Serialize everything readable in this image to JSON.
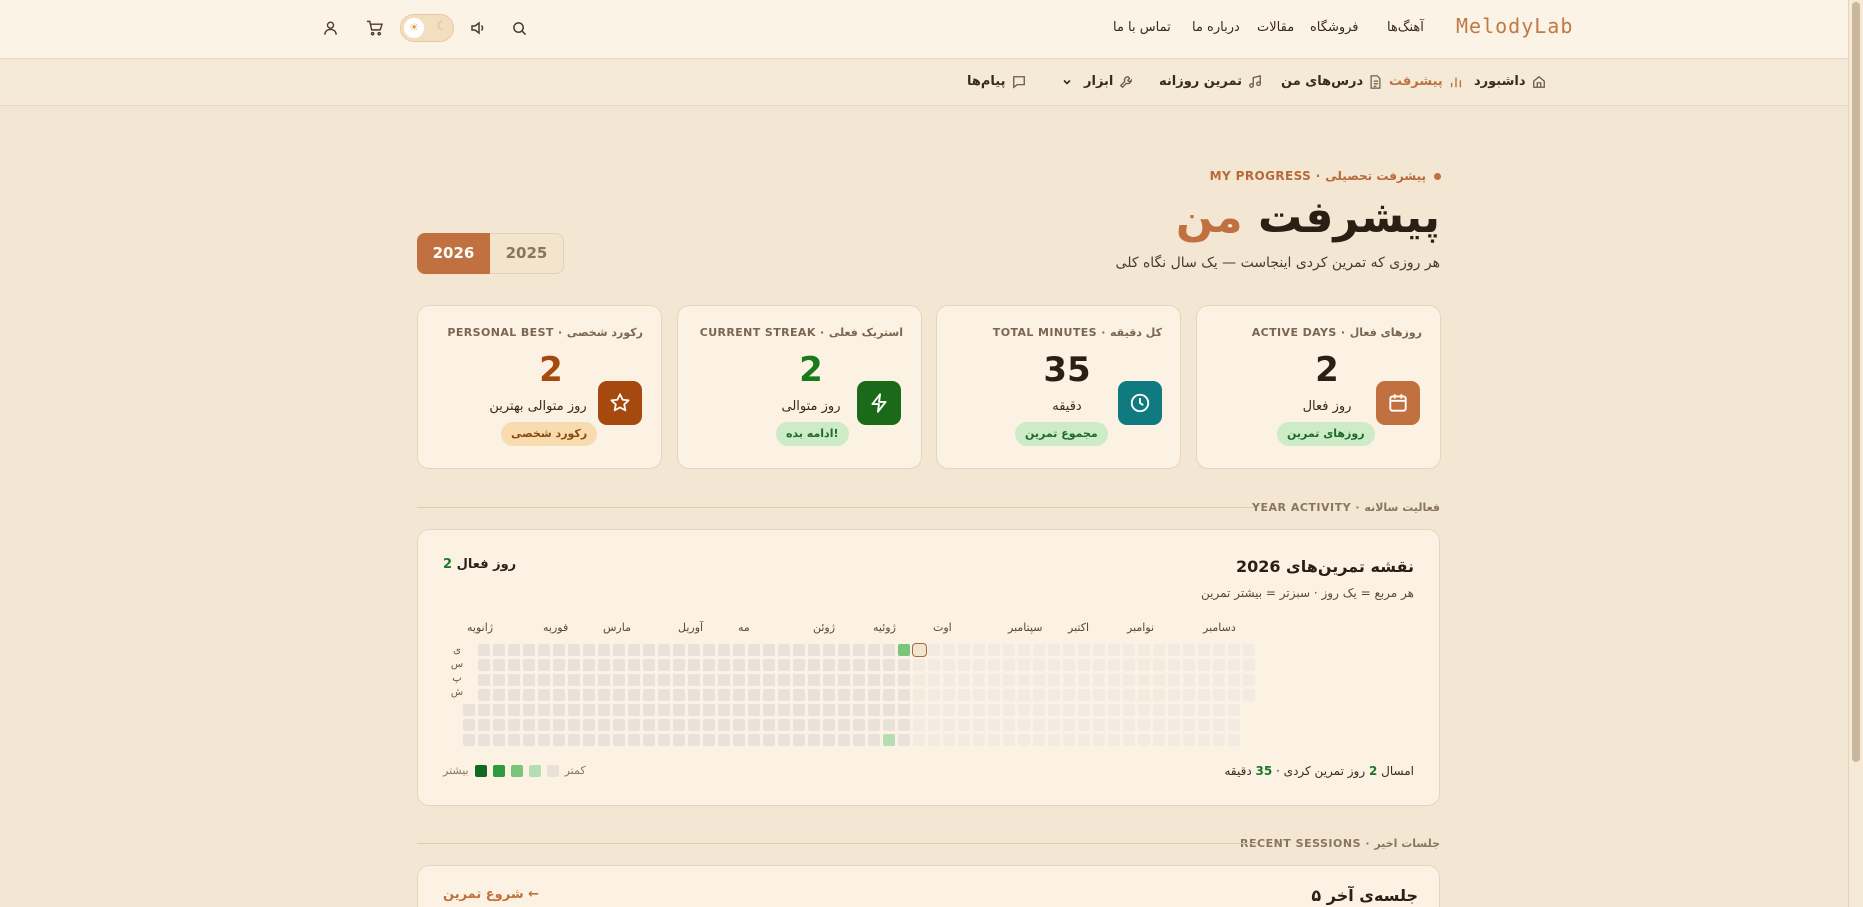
{
  "brand": {
    "logo": "MelodyLab"
  },
  "top_nav": [
    "آهنگ‌ها",
    "فروشگاه",
    "مقالات",
    "درباره ما",
    "تماس با ما"
  ],
  "sub_nav": [
    {
      "label": "داشبورد",
      "icon": "home-icon"
    },
    {
      "label": "پیشرفت",
      "icon": "chart-bars-icon",
      "active": true
    },
    {
      "label": "درس‌های من",
      "icon": "document-icon"
    },
    {
      "label": "تمرین روزانه",
      "icon": "music-note-icon"
    },
    {
      "label": "ابزار",
      "icon": "wrench-icon"
    },
    {
      "label": "پیام‌ها",
      "icon": "chat-icon"
    }
  ],
  "hero": {
    "eyebrow": "MY PROGRESS · پیشرفت تحصیلی",
    "title_main": "پیشرفت",
    "title_accent": "من",
    "subtitle": "هر روزی که تمرین کردی اینجاست — یک سال نگاه کلی",
    "years": [
      "2026",
      "2025"
    ],
    "selected_year": "2026"
  },
  "stats": [
    {
      "label": "ACTIVE DAYS · روزهای فعال",
      "value": "2",
      "caption": "روز فعال",
      "badge": "روزهای تمرین",
      "icon": "calendar-icon"
    },
    {
      "label": "TOTAL MINUTES · کل دقیقه",
      "value": "35",
      "caption": "دقیقه",
      "badge": "مجموع تمرین",
      "icon": "clock-icon"
    },
    {
      "label": "CURRENT STREAK · استریک فعلی",
      "value": "2",
      "caption": "روز متوالی",
      "badge": "ادامه بده!",
      "icon": "lightning-icon"
    },
    {
      "label": "PERSONAL BEST · رکورد شخصی",
      "value": "2",
      "caption": "روز متوالی بهترین",
      "badge": "رکورد شخصی",
      "icon": "star-icon"
    }
  ],
  "year_activity": {
    "section_label": "YEAR ACTIVITY · فعالیت سالانه",
    "title": "نقشه تمرین‌های 2026",
    "subtitle": "هر مربع = یک روز · سبزتر = بیشتر تمرین",
    "active_count": "2",
    "active_suffix": "روز فعال",
    "months": [
      "دسامبر",
      "نوامبر",
      "اکتبر",
      "سپتامبر",
      "اوت",
      "ژوئیه",
      "ژوئن",
      "مه",
      "آوریل",
      "مارس",
      "فوریه",
      "ژانویه"
    ],
    "weekdays": [
      "ی",
      "س",
      "پ",
      "ش"
    ],
    "footer_prefix": "امسال",
    "footer_days": "2",
    "footer_mid": "روز تمرین کردی ·",
    "footer_minutes": "35",
    "footer_suffix": "دقیقه",
    "legend_less": "کمتر",
    "legend_more": "بیشتر",
    "legend_colors": [
      "#e8e2da",
      "#b5dfb0",
      "#7cc47a",
      "#2e9a3e",
      "#0f6a1f"
    ]
  },
  "recent": {
    "section_label": "RECENT SESSIONS · جلسات اخیر",
    "title": "۵ جلسه‌ی آخر",
    "action": "شروع تمرین ←"
  },
  "colors": {
    "accent": "#c0713f",
    "green": "#1a7a2a",
    "teal": "#0f7a80"
  }
}
